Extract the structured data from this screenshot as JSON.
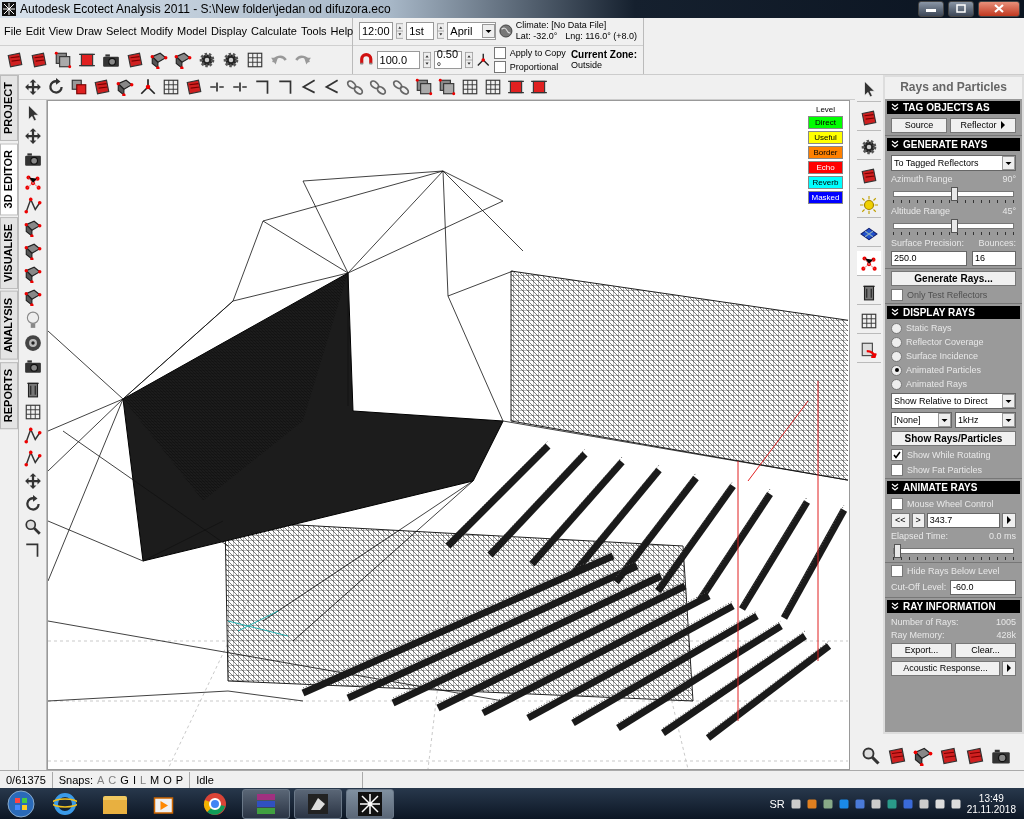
{
  "window": {
    "title": "Autodesk Ecotect Analysis 2011 - S:\\New folder\\jedan od difuzora.eco"
  },
  "menu": [
    "File",
    "Edit",
    "View",
    "Draw",
    "Select",
    "Modify",
    "Model",
    "Display",
    "Calculate",
    "Tools",
    "Help"
  ],
  "date_time": {
    "time": "12:00",
    "day": "1st",
    "month": "April"
  },
  "climate": {
    "label": "Climate: [No Data File]",
    "lat": "Lat: -32.0°",
    "lng": "Lng: 116.0° (+8.0)"
  },
  "transform": {
    "value": "100.0",
    "angle": "0.50 °",
    "options": [
      {
        "label": "Apply to Copy",
        "checked": false
      },
      {
        "label": "Proportional",
        "checked": false
      }
    ]
  },
  "current_zone": {
    "label": "Current Zone:",
    "value": "Outside"
  },
  "side_tabs": [
    {
      "label": "PROJECT",
      "selected": false
    },
    {
      "label": "3D EDITOR",
      "selected": true
    },
    {
      "label": "VISUALISE",
      "selected": false
    },
    {
      "label": "ANALYSIS",
      "selected": false
    },
    {
      "label": "REPORTS",
      "selected": false
    }
  ],
  "legend": {
    "title": "Level",
    "items": [
      {
        "label": "Direct",
        "color": "#00ff00"
      },
      {
        "label": "Useful",
        "color": "#ffff00"
      },
      {
        "label": "Border",
        "color": "#ff8000"
      },
      {
        "label": "Echo",
        "color": "#ff0000"
      },
      {
        "label": "Reverb",
        "color": "#00ffff"
      },
      {
        "label": "Masked",
        "color": "#0000ff"
      }
    ]
  },
  "panel": {
    "title": "Rays and Particles",
    "tag_objects": {
      "header": "TAG OBJECTS AS",
      "source": "Source",
      "reflector": "Reflector"
    },
    "generate_rays": {
      "header": "GENERATE RAYS",
      "target": "To Tagged Reflectors",
      "sliders": [
        {
          "label": "Azimuth Range",
          "reading": "90°",
          "level": 0.5
        },
        {
          "label": "Altitude Range",
          "reading": "45°",
          "level": 0.5
        }
      ],
      "precision_label": "Surface Precision:",
      "precision": "250.0",
      "bounces_label": "Bounces:",
      "bounces": "16",
      "button": "Generate Rays...",
      "only_test": {
        "label": "Only Test Reflectors",
        "checked": false,
        "disabled": true
      }
    },
    "display_rays": {
      "header": "DISPLAY RAYS",
      "options": [
        {
          "label": "Static Rays",
          "selected": false
        },
        {
          "label": "Reflector Coverage",
          "selected": false
        },
        {
          "label": "Surface Incidence",
          "selected": false
        },
        {
          "label": "Animated Particles",
          "selected": true
        },
        {
          "label": "Animated Rays",
          "selected": false
        }
      ],
      "relative": "Show Relative to Direct",
      "filter": "[None]",
      "frequency": "1kHz",
      "button": "Show Rays/Particles",
      "checks": [
        {
          "label": "Show While Rotating",
          "checked": true
        },
        {
          "label": "Show Fat Particles",
          "checked": false
        }
      ]
    },
    "animate_rays": {
      "header": "ANIMATE RAYS",
      "mouse_wheel": {
        "label": "Mouse Wheel Control",
        "checked": false
      },
      "rewind": "<<",
      "step": ">",
      "value": "343.7",
      "elapsed_label": "Elapsed Time:",
      "elapsed": "0.0 ms",
      "elapsed_slider": {
        "level": 0
      },
      "hide_below": {
        "label": "Hide Rays Below Level",
        "checked": false
      },
      "cutoff_label": "Cut-Off Level:",
      "cutoff": "-60.0"
    },
    "ray_information": {
      "header": "RAY INFORMATION",
      "stats": [
        {
          "label": "Number of Rays:",
          "value": "1005"
        },
        {
          "label": "Ray Memory:",
          "value": "428k"
        }
      ],
      "buttons": [
        "Export...",
        "Clear..."
      ],
      "acoustic": "Acoustic Response..."
    }
  },
  "status_bar": {
    "count": "0/61375",
    "snaps_label": "Snaps:",
    "snaps": [
      {
        "label": "A",
        "on": false
      },
      {
        "label": "C",
        "on": false
      },
      {
        "label": "G",
        "on": true
      },
      {
        "label": "I",
        "on": true
      },
      {
        "label": "L",
        "on": false
      },
      {
        "label": "M",
        "on": true
      },
      {
        "label": "O",
        "on": true
      },
      {
        "label": "P",
        "on": true
      }
    ],
    "status": "Idle"
  },
  "taskbar": {
    "language": "SR",
    "time": "13:49",
    "date": "21.11.2018"
  }
}
